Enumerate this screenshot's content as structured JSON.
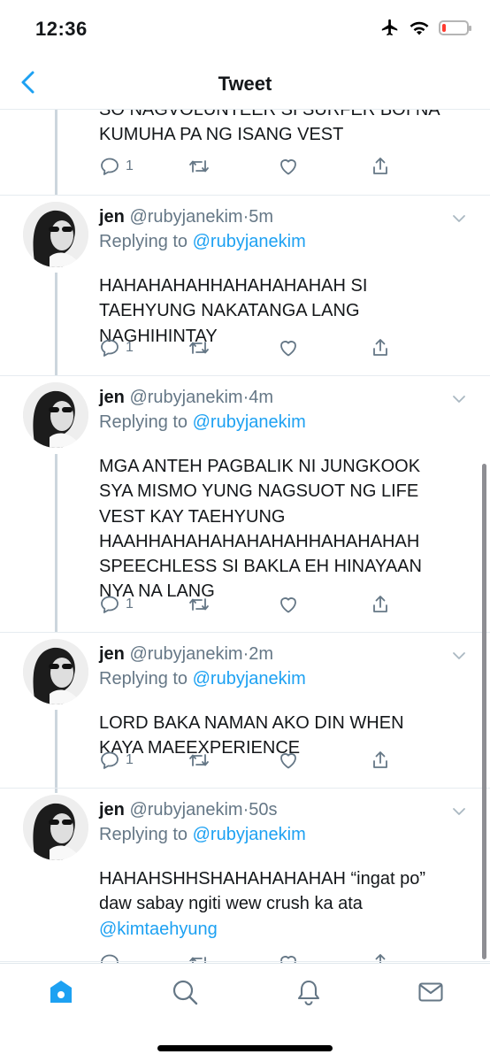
{
  "status_bar": {
    "time": "12:36",
    "icons": [
      "airplane-icon",
      "wifi-icon",
      "battery-icon"
    ],
    "battery_color": "#ff3b30",
    "battery_level": 0.15
  },
  "nav": {
    "back_icon": "chevron-left-icon",
    "title": "Tweet"
  },
  "colors": {
    "accent": "#1da1f2",
    "muted": "#657786",
    "text": "#14171a",
    "thread_line": "#ccd6dd"
  },
  "top_tweet_partial": {
    "text": "SO NAGVOLUNTEER SI SURFER BOI NA\nKUMUHA PA NG ISANG VEST",
    "reply_count": "1"
  },
  "tweets": [
    {
      "name": "jen",
      "handle": "@rubyjanekim",
      "time": "5m",
      "replying_prefix": "Replying to",
      "replying_to": "@rubyjanekim",
      "text": "HAHAHAHAHHAHAHAHAHAH SI\nTAEHYUNG NAKATANGA LANG\nNAGHIHINTAY",
      "reply_count": "1"
    },
    {
      "name": "jen",
      "handle": "@rubyjanekim",
      "time": "4m",
      "replying_prefix": "Replying to",
      "replying_to": "@rubyjanekim",
      "text": "MGA ANTEH PAGBALIK NI JUNGKOOK\nSYA MISMO YUNG NAGSUOT NG LIFE\nVEST KAY TAEHYUNG\nHAAHHAHAHAHAHAHAHHAHAHAHAH\nSPEECHLESS SI BAKLA EH HINAYAAN\nNYA NA LANG",
      "reply_count": "1"
    },
    {
      "name": "jen",
      "handle": "@rubyjanekim",
      "time": "2m",
      "replying_prefix": "Replying to",
      "replying_to": "@rubyjanekim",
      "text": "LORD BAKA NAMAN AKO DIN WHEN\nKAYA MAEEXPERIENCE",
      "reply_count": "1"
    },
    {
      "name": "jen",
      "handle": "@rubyjanekim",
      "time": "50s",
      "replying_prefix": "Replying to",
      "replying_to": "@rubyjanekim",
      "text": "HAHAHSHHSHAHAHAHAHAH “ingat po”\ndaw sabay ngiti wew crush ka ata",
      "mention": "@kimtaehyung",
      "reply_count": ""
    }
  ],
  "tab_bar": {
    "tabs": [
      "home-icon",
      "search-icon",
      "notifications-bell-icon",
      "messages-mail-icon"
    ],
    "active": "home-icon"
  }
}
